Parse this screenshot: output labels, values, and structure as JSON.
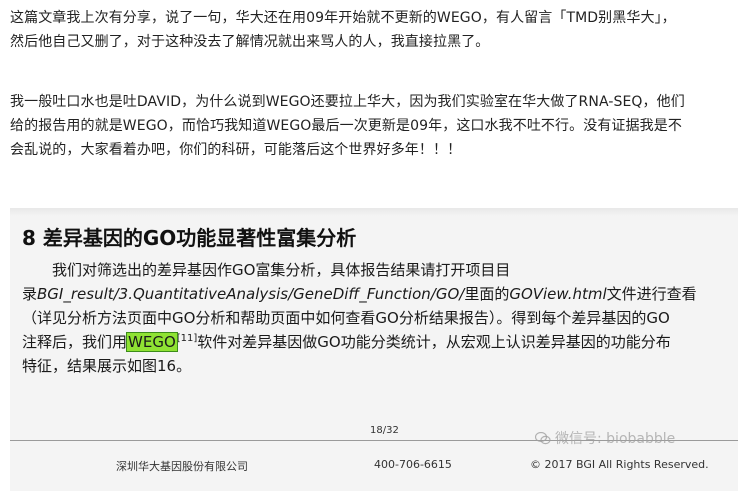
{
  "article": {
    "paragraph1": [
      "这篇文章我上次有分享，说了一句，华大还在用09年开始就不更新的WEGO，有人留言「TMD别黑华大」，",
      "然后他自己又删了，对于这种没去了解情况就出来骂人的人，我直接拉黑了。"
    ],
    "paragraph2": [
      "我一般吐口水也是吐DAVID，为什么说到WEGO还要拉上华大，因为我们实验室在华大做了RNA-SEQ，他们",
      "给的报告用的就是WEGO，而恰巧我知道WEGO最后一次更新是09年，这口水我不吐不行。没有证据我是不",
      "会乱说的，大家看着办吧，你们的科研，可能落后这个世界好多年！！！"
    ]
  },
  "report": {
    "heading": "8 差异基因的GO功能显著性富集分析",
    "line1": "我们对筛选出的差异基因作GO富集分析，具体报告结果请打开项目目",
    "line2_pre": "录",
    "line2_path": "BGI_result/3.QuantitativeAnalysis/GeneDiff_Function/GO/",
    "line2_mid": "里面的",
    "line2_file": "GOView.html",
    "line2_post": "文件进行查看",
    "line3": "（详见分析方法页面中GO分析和帮助页面中如何查看GO分析结果报告）。得到每个差异基因的GO",
    "line4_pre": "注释后，我们用",
    "line4_highlight": "WEGO",
    "line4_ref": "[11]",
    "line4_post": "软件对差异基因做GO功能分类统计，从宏观上认识差异基因的功能分布",
    "line5": "特征，结果展示如图16。",
    "page_number": "18/32",
    "footer_company": "深圳华大基因股份有限公司",
    "footer_phone": "400-706-6615",
    "footer_copyright": "© 2017 BGI All Rights Reserved."
  },
  "watermark": {
    "icon": "wechat-icon",
    "text": "微信号: biobabble"
  },
  "colors": {
    "highlight": "#8fe233",
    "text": "#222222"
  }
}
